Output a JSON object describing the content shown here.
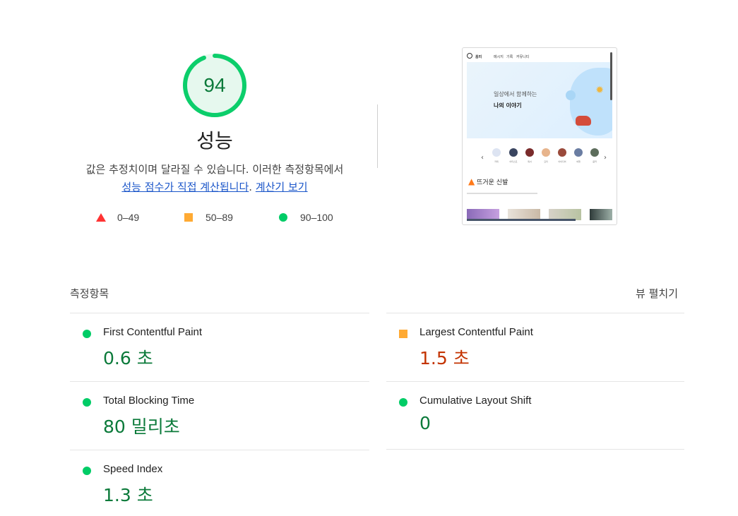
{
  "score": {
    "value": "94",
    "fraction": 0.94,
    "title": "성능",
    "color": "#0cce6b",
    "description_prefix": "값은 추정치이며 달라질 수 있습니다. 이러한 측정항목에서",
    "link1": "성능 점수가 직접 계산됩니다",
    "separator": ". ",
    "link2": "계산기 보기"
  },
  "legend": [
    {
      "shape": "triangle-icon",
      "label": "0–49",
      "color": "#ff3333"
    },
    {
      "shape": "square-icon",
      "label": "50–89",
      "color": "#ffaa33"
    },
    {
      "shape": "circle-icon",
      "label": "90–100",
      "color": "#00cc66"
    }
  ],
  "screenshot": {
    "nav": [
      "홈피",
      "메시지",
      "기록",
      "커뮤니티"
    ],
    "hero_line1": "일상에서 함께하는",
    "hero_line2": "나의 이야기",
    "categories": [
      "카테",
      "아티스트",
      "독서",
      "요리",
      "아이디어",
      "여행",
      "음악"
    ],
    "hot_title": "뜨거운 신발"
  },
  "metrics_section": {
    "title": "측정항목",
    "expand_label": "뷰 펼치기"
  },
  "metrics": [
    {
      "name": "First Contentful Paint",
      "value": "0.6 초",
      "rating": "good"
    },
    {
      "name": "Largest Contentful Paint",
      "value": "1.5 초",
      "rating": "average"
    },
    {
      "name": "Total Blocking Time",
      "value": "80 밀리초",
      "rating": "good"
    },
    {
      "name": "Cumulative Layout Shift",
      "value": "0",
      "rating": "good"
    },
    {
      "name": "Speed Index",
      "value": "1.3 초",
      "rating": "good"
    }
  ]
}
